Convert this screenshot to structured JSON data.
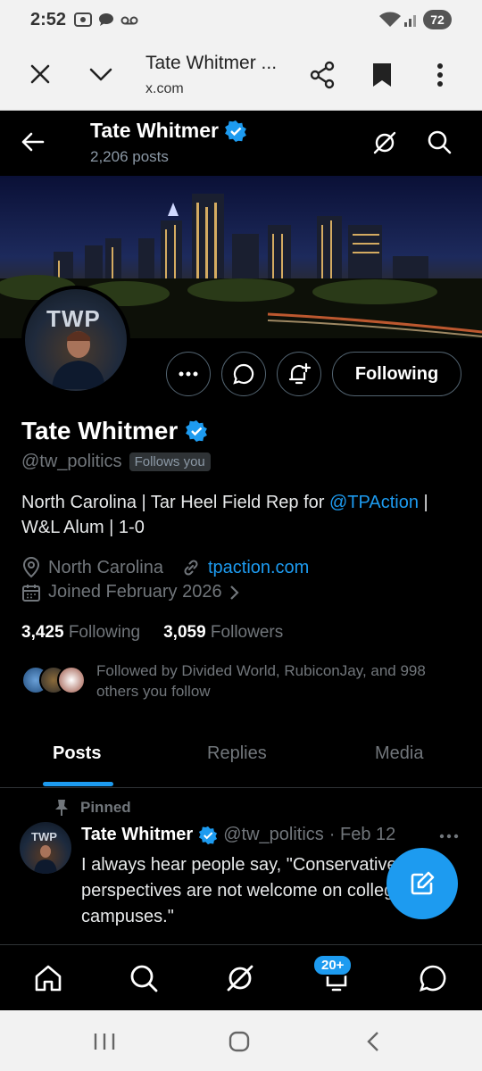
{
  "status": {
    "time": "2:52",
    "battery": "72"
  },
  "browser": {
    "title": "Tate Whitmer ...",
    "url": "x.com"
  },
  "header": {
    "name": "Tate Whitmer",
    "posts": "2,206 posts"
  },
  "avatar": {
    "text": "TWP"
  },
  "profile": {
    "following_button": "Following",
    "name": "Tate Whitmer",
    "handle": "@tw_politics",
    "follows_you": "Follows you",
    "bio_part1": "North Carolina | Tar Heel Field Rep for ",
    "bio_link": "@TPAction",
    "bio_part2": " | W&L Alum | 1-0",
    "location": "North Carolina",
    "website": "tpaction.com",
    "joined": "Joined February 2026",
    "following_count": "3,425",
    "following_label": "Following",
    "followers_count": "3,059",
    "followers_label": "Followers",
    "followed_by": "Followed by Divided World, RubiconJay, and 998 others you follow"
  },
  "tabs": [
    {
      "label": "Posts"
    },
    {
      "label": "Replies"
    },
    {
      "label": "Media"
    }
  ],
  "pinned_post": {
    "pinned_label": "Pinned",
    "avatar_text": "TWP",
    "name": "Tate Whitmer",
    "handle": "@tw_politics",
    "date": "· Feb 12",
    "text": "I always hear people say, \"Conservative perspectives are not welcome on college campuses.\""
  },
  "bottom_nav": {
    "notifications_badge": "20+"
  },
  "colors": {
    "accent": "#1d9bf0",
    "background": "#000000",
    "muted": "#71767b"
  }
}
